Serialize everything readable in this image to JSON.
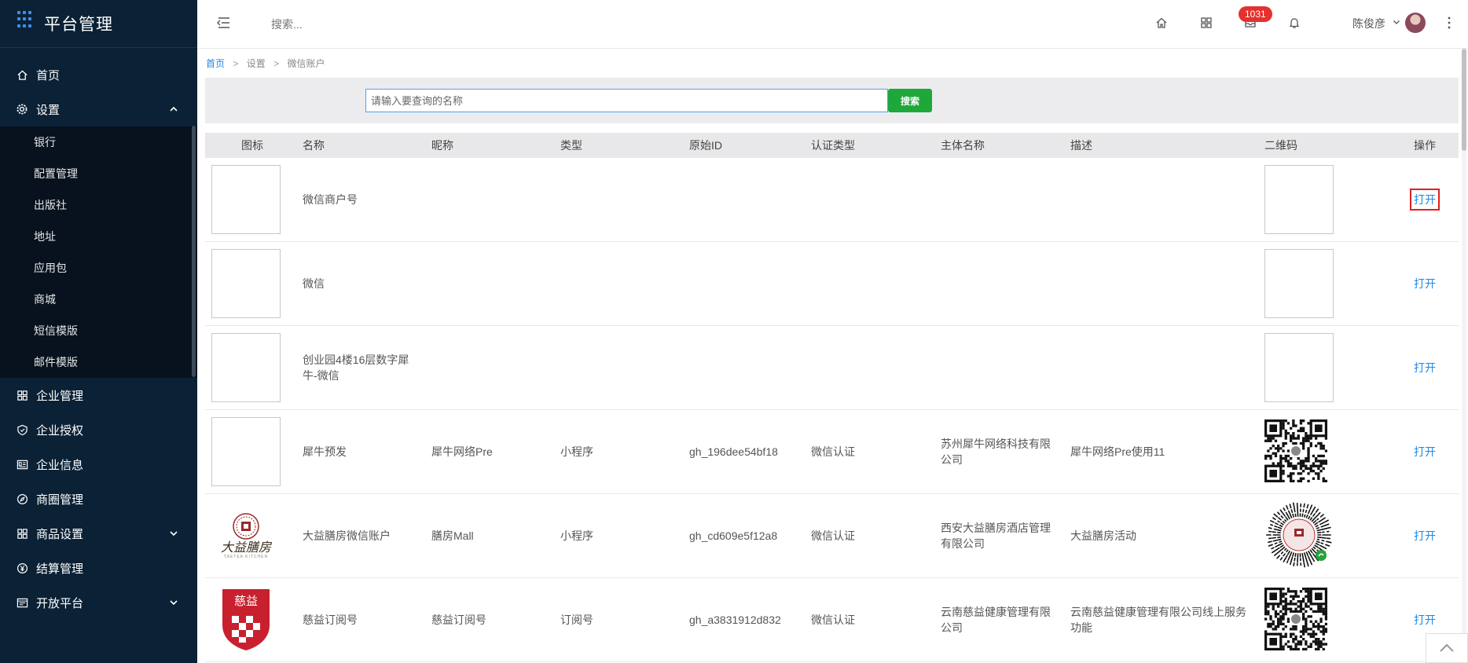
{
  "sidebar": {
    "brand": "平台管理",
    "items": [
      {
        "label": "首页",
        "icon": "home-icon"
      },
      {
        "label": "设置",
        "icon": "gear-icon",
        "expanded": true,
        "children": [
          "银行",
          "配置管理",
          "出版社",
          "地址",
          "应用包",
          "商城",
          "短信模版",
          "邮件模版"
        ]
      },
      {
        "label": "企业管理",
        "icon": "building-icon"
      },
      {
        "label": "企业授权",
        "icon": "shield-check-icon"
      },
      {
        "label": "企业信息",
        "icon": "id-card-icon"
      },
      {
        "label": "商圈管理",
        "icon": "compass-icon"
      },
      {
        "label": "商品设置",
        "icon": "grid-icon",
        "expandable": true
      },
      {
        "label": "结算管理",
        "icon": "yen-coin-icon"
      },
      {
        "label": "开放平台",
        "icon": "terminal-icon",
        "expandable": true
      }
    ]
  },
  "topbar": {
    "search_placeholder": "搜索...",
    "badge_count": "1031",
    "user_name": "陈俊彦"
  },
  "breadcrumb": {
    "home": "首页",
    "level2": "设置",
    "current": "微信账户"
  },
  "search": {
    "placeholder": "请输入要查询的名称",
    "button": "搜索"
  },
  "table": {
    "headers": {
      "icon": "图标",
      "name": "名称",
      "nick": "昵称",
      "type": "类型",
      "orig": "原始ID",
      "auth": "认证类型",
      "subj": "主体名称",
      "desc": "描述",
      "qr": "二维码",
      "op": "操作"
    },
    "rows": [
      {
        "name": "微信商户号",
        "nick": "",
        "type": "",
        "orig": "",
        "auth": "",
        "subj": "",
        "desc": "",
        "op": "打开",
        "icon": "placeholder",
        "qr": "placeholder"
      },
      {
        "name": "微信",
        "nick": "",
        "type": "",
        "orig": "",
        "auth": "",
        "subj": "",
        "desc": "",
        "op": "打开",
        "icon": "placeholder",
        "qr": "placeholder"
      },
      {
        "name": "创业园4楼16层数字犀牛-微信",
        "nick": "",
        "type": "",
        "orig": "",
        "auth": "",
        "subj": "",
        "desc": "",
        "op": "打开",
        "icon": "placeholder",
        "qr": "placeholder"
      },
      {
        "name": "犀牛预发",
        "nick": "犀牛网络Pre",
        "type": "小程序",
        "orig": "gh_196dee54bf18",
        "auth": "微信认证",
        "subj": "苏州犀牛网络科技有限公司",
        "desc": "犀牛网络Pre使用11",
        "op": "打开",
        "icon": "placeholder",
        "qr": "qr-code"
      },
      {
        "name": "大益膳房微信账户",
        "nick": "膳房Mall",
        "type": "小程序",
        "orig": "gh_cd609e5f12a8",
        "auth": "微信认证",
        "subj": "西安大益膳房酒店管理有限公司",
        "desc": "大益膳房活动",
        "op": "打开",
        "icon": "dayi-logo",
        "qr": "mini-program-code",
        "logo_text": "大益膳房",
        "logo_sub": "TAETEA KITCHEN"
      },
      {
        "name": "慈益订阅号",
        "nick": "慈益订阅号",
        "type": "订阅号",
        "orig": "gh_a3831912d832",
        "auth": "微信认证",
        "subj": "云南慈益健康管理有限公司",
        "desc": "云南慈益健康管理有限公司线上服务功能",
        "op": "打开",
        "icon": "ciyi-logo",
        "qr": "qr-code",
        "logo_text": "慈益"
      }
    ]
  },
  "colors": {
    "sidebar_bg": "#0b2135",
    "accent": "#1e88e5",
    "search_btn": "#1fa83a",
    "badge": "#e5312e",
    "highlight": "#e02020"
  }
}
